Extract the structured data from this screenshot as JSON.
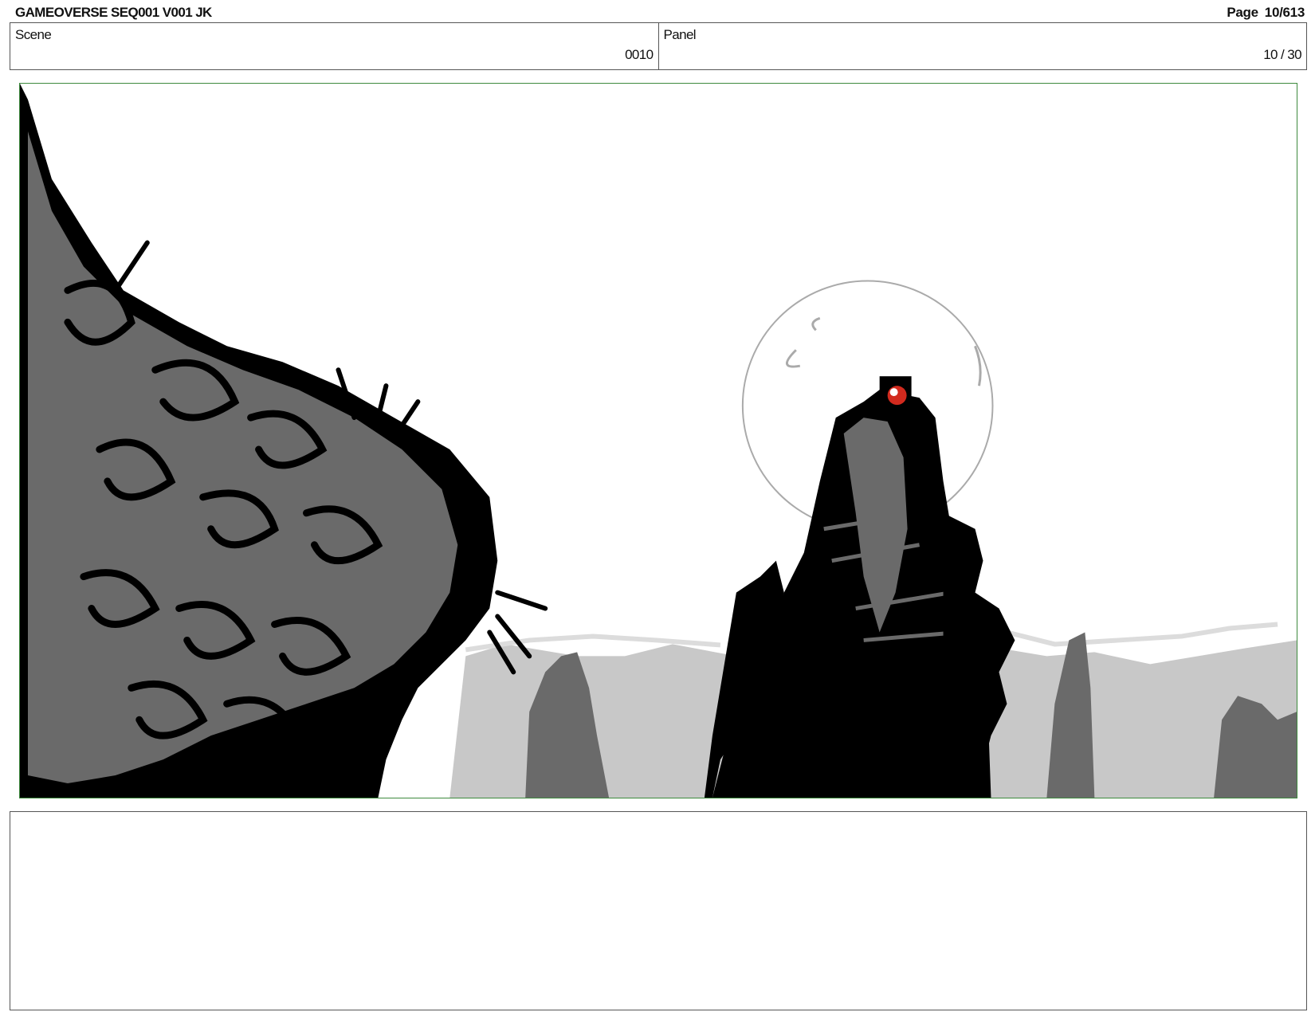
{
  "header": {
    "doc_title": "GAMEOVERSE SEQ001 V001 JK",
    "page_label": "Page",
    "page_value": "10/613"
  },
  "info_bar": {
    "scene_label": "Scene",
    "scene_value": "0010",
    "panel_label": "Panel",
    "panel_value": "10 / 30"
  },
  "colors": {
    "frame_border": "#3d8a3d",
    "ink": "#000000",
    "dark_grey": "#6a6a6a",
    "light_grey": "#c8c8c8",
    "accent_red": "#d22a1e"
  },
  "notes": {
    "text": ""
  }
}
